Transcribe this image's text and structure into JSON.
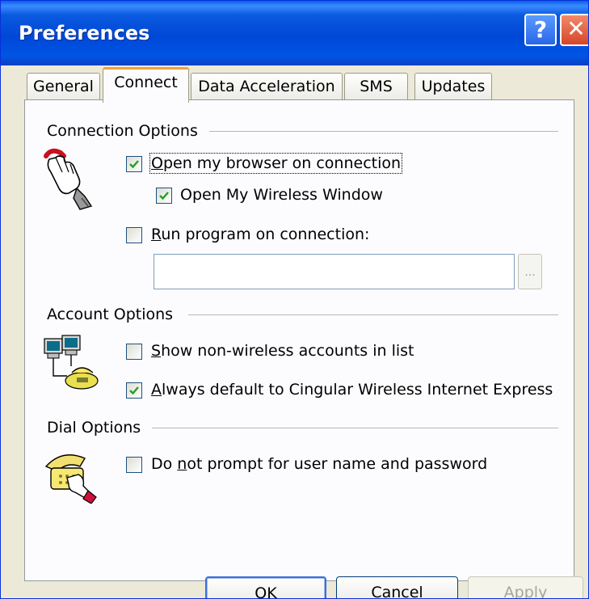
{
  "window": {
    "title": "Preferences"
  },
  "tabs": [
    {
      "label": "General",
      "active": false
    },
    {
      "label": "Connect",
      "active": true
    },
    {
      "label": "Data Acceleration",
      "active": false
    },
    {
      "label": "SMS",
      "active": false
    },
    {
      "label": "Updates",
      "active": false
    }
  ],
  "connection_options": {
    "title": "Connection Options",
    "open_browser": {
      "label_mnemonic": "O",
      "label_rest": "pen my browser on connection",
      "checked": true
    },
    "open_wireless_window": {
      "label": "Open My Wireless Window",
      "checked": true
    },
    "run_program": {
      "label_mnemonic": "R",
      "label_rest": "un program on connection:",
      "checked": false
    },
    "program_path": {
      "value": ""
    },
    "browse_label": "..."
  },
  "account_options": {
    "title": "Account Options",
    "show_non_wireless": {
      "label_mnemonic": "S",
      "label_rest": "how non-wireless accounts in list",
      "checked": false
    },
    "always_default": {
      "label_mnemonic": "A",
      "label_rest": "lways default to Cingular Wireless Internet Express",
      "checked": true
    }
  },
  "dial_options": {
    "title": "Dial Options",
    "do_not_prompt": {
      "label_before": "Do ",
      "label_mnemonic": "n",
      "label_rest": "ot prompt for user name and password",
      "checked": false
    }
  },
  "buttons": {
    "ok": "OK",
    "cancel": "Cancel",
    "apply": "Apply"
  },
  "icons": {
    "connection": "hand-plug-icon",
    "account": "computers-network-icon",
    "dial": "phone-hand-icon",
    "help": "help-icon",
    "close": "close-icon"
  }
}
